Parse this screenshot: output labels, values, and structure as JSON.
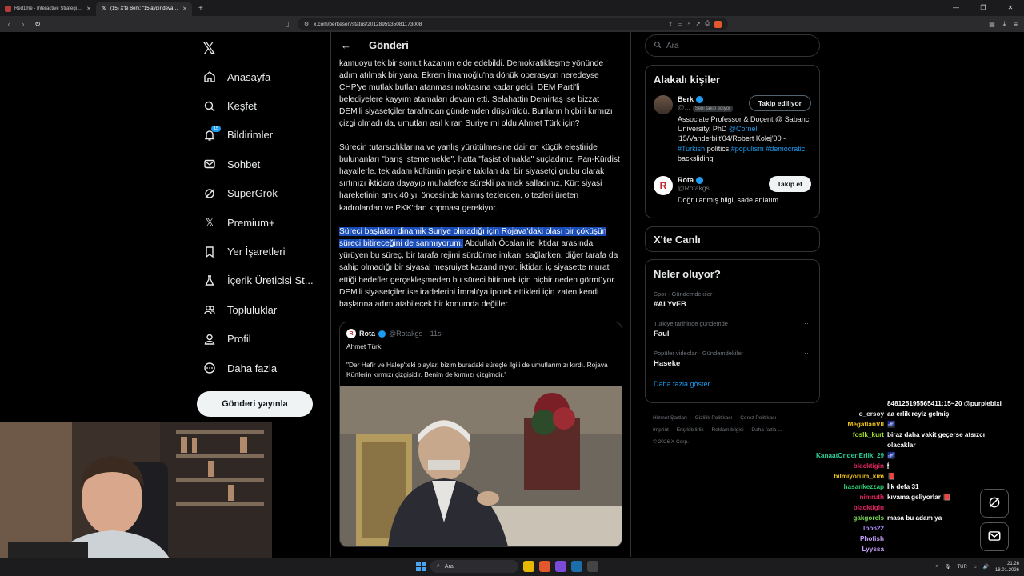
{
  "browser": {
    "tabs": [
      {
        "title": "Red1me - Interactive Strategic Map",
        "active": false
      },
      {
        "title": "(15) X'te Berk: \"15 aydır devam e",
        "active": true
      }
    ],
    "url": "x.com/berkesen/status/2012895935081173008"
  },
  "sidebar": {
    "items": [
      {
        "label": "Anasayfa",
        "icon": "home-icon"
      },
      {
        "label": "Keşfet",
        "icon": "search-icon"
      },
      {
        "label": "Bildirimler",
        "icon": "bell-icon",
        "badge": "15"
      },
      {
        "label": "Sohbet",
        "icon": "mail-icon"
      },
      {
        "label": "SuperGrok",
        "icon": "grok-icon"
      },
      {
        "label": "Premium+",
        "icon": "x-icon"
      },
      {
        "label": "Yer İşaretleri",
        "icon": "bookmark-icon"
      },
      {
        "label": "İçerik Üreticisi St...",
        "icon": "flask-icon"
      },
      {
        "label": "Topluluklar",
        "icon": "people-icon"
      },
      {
        "label": "Profil",
        "icon": "person-icon"
      },
      {
        "label": "Daha fazla",
        "icon": "more-circle-icon"
      }
    ],
    "post_button": "Gönderi yayınla"
  },
  "main": {
    "header_title": "Gönderi",
    "paragraphs": {
      "p1": "kamuoyu tek bir somut kazanım elde edebildi. Demokratikleşme yönünde adım atılmak bir yana, Ekrem İmamoğlu'na dönük operasyon neredeyse CHP'ye mutlak butlan atanması noktasına kadar geldi. DEM Parti'li belediyelere kayyım atamaları devam etti. Selahattin Demirtaş ise bizzat DEM'li siyasetçiler tarafından gündemden düşürüldü. Bunların hiçbiri kırmızı çizgi olmadı da, umutları asıl kıran Suriye mi oldu Ahmet Türk için?",
      "p2": "Sürecin tutarsızlıklarına ve yanlış yürütülmesine dair en küçük eleştiride bulunanları \"barış istememekle\", hatta \"faşist olmakla\" suçladınız. Pan-Kürdist hayallerle, tek adam kültünün peşine takılan dar bir siyasetçi grubu olarak sırtınızı iktidara dayayıp muhalefete sürekli parmak salladınız. Kürt siyasi hareketinin artık 40 yıl öncesinde kalmış tezlerden, o tezleri üreten kadrolardan ve PKK'dan kopması gerekiyor.",
      "p3_highlight": "Süreci başlatan dinamik Suriye olmadığı için Rojava'daki olası bir çöküşün süreci bitireceğini de sanmıyorum.",
      "p3_rest": " Abdullah Öcalan ile iktidar arasında yürüyen bu süreç, bir tarafa rejimi sürdürme imkanı sağlarken, diğer tarafa da sahip olmadığı bir siyasal meşruiyet kazandırıyor. İktidar, iç siyasette murat ettiği hedefler gerçekleşmeden bu süreci bitirmek için hiçbir neden görmüyor. DEM'li siyasetçiler ise iradelerini İmralı'ya ipotek ettikleri için zaten kendi başlarına adım atabilecek bir konumda değiller."
    },
    "quote": {
      "name": "Rota",
      "handle": "@Rotakgs",
      "time": "· 11s",
      "line1": "Ahmet Türk:",
      "line2": "\"Der Hafir ve Halep'teki olaylar, bizim buradaki süreçle ilgili de umutlarımızı kırdı. Rojava Kürtlerin kırmızı çizgisidir. Benim de kırmızı çizgimdir.\""
    }
  },
  "right": {
    "search_placeholder": "Ara",
    "related_title": "Alakalı kişiler",
    "people": [
      {
        "name": "Berk",
        "handle": "@...",
        "follows_you": "Seni takip ediyor",
        "button": "Takip ediliyor",
        "bio_a": "Associate Professor & Doçent @ Sabancı University, PhD ",
        "bio_link1": "@Cornell",
        "bio_b": " '15/Vanderbilt'04/Robert Kolej'00 - ",
        "bio_link2": "#Turkish",
        "bio_c": " politics ",
        "bio_link3": "#populism",
        "bio_link4": "#democratic",
        "bio_d": " backsliding"
      },
      {
        "name": "Rota",
        "handle": "@Rotakgs",
        "button": "Takip et",
        "bio": "Doğrulanmış bilgi, sade anlatım"
      }
    ],
    "live_title": "X'te Canlı",
    "trends_title": "Neler oluyor?",
    "trends": [
      {
        "meta": "Spor · Gündemdekiler",
        "name": "#ALYvFB"
      },
      {
        "meta": "Türkiye tarihinde gündemde",
        "name": "Faul"
      },
      {
        "meta": "Popüler videolar · Gündemdekiler",
        "name": "Haseke"
      }
    ],
    "show_more": "Daha fazla göster",
    "footer": [
      "Hizmet Şartları",
      "Gizlilik Politikası",
      "Çerez Politikası",
      "Imprint",
      "Erişilebilirlik",
      "Reklam bilgisi",
      "Daha fazla ...",
      "© 2026 X Corp."
    ]
  },
  "chat": [
    {
      "user": "",
      "msg": "848125195565411:15~20 @purplebixi",
      "color": "#ffffff"
    },
    {
      "user": "o_ersoy",
      "msg": "aa erlik reyiz gelmiş",
      "color": "#e6e6e6"
    },
    {
      "user": "MegatlanVII",
      "msg": "🌌",
      "color": "#f0c419"
    },
    {
      "user": "foslk_kurt",
      "msg": "biraz daha vakit geçerse atsızcı",
      "color": "#a6e22e"
    },
    {
      "user": "",
      "msg": "olacaklar",
      "color": "#ffffff"
    },
    {
      "user": "KanaatOnderiErlik_29",
      "msg": "🌌",
      "color": "#2ecc9a"
    },
    {
      "user": "blacktigin",
      "msg": "🕯",
      "color": "#e0245e"
    },
    {
      "user": "bilmiyorum_kim",
      "msg": "📕",
      "color": "#f0c419"
    },
    {
      "user": "hasankezzap",
      "msg": "İlk defa 31",
      "color": "#2ecc71"
    },
    {
      "user": "nimruth",
      "msg": "kıvama geliyorlar 📕",
      "color": "#e0245e"
    },
    {
      "user": "blacktigin",
      "msg": "",
      "color": "#e0245e"
    },
    {
      "user": "gakgorels",
      "msg": "masa bu adam ya",
      "color": "#7ed957"
    },
    {
      "user": "lbo622",
      "msg": "",
      "color": "#b18cff"
    },
    {
      "user": "Phofish",
      "msg": "",
      "color": "#c8a2ff"
    },
    {
      "user": "Lyyssa",
      "msg": "",
      "color": "#c8a2ff"
    }
  ],
  "taskbar": {
    "search": "Ara",
    "lang": "TUR",
    "time": "21:26",
    "date": "18.01.2026"
  }
}
